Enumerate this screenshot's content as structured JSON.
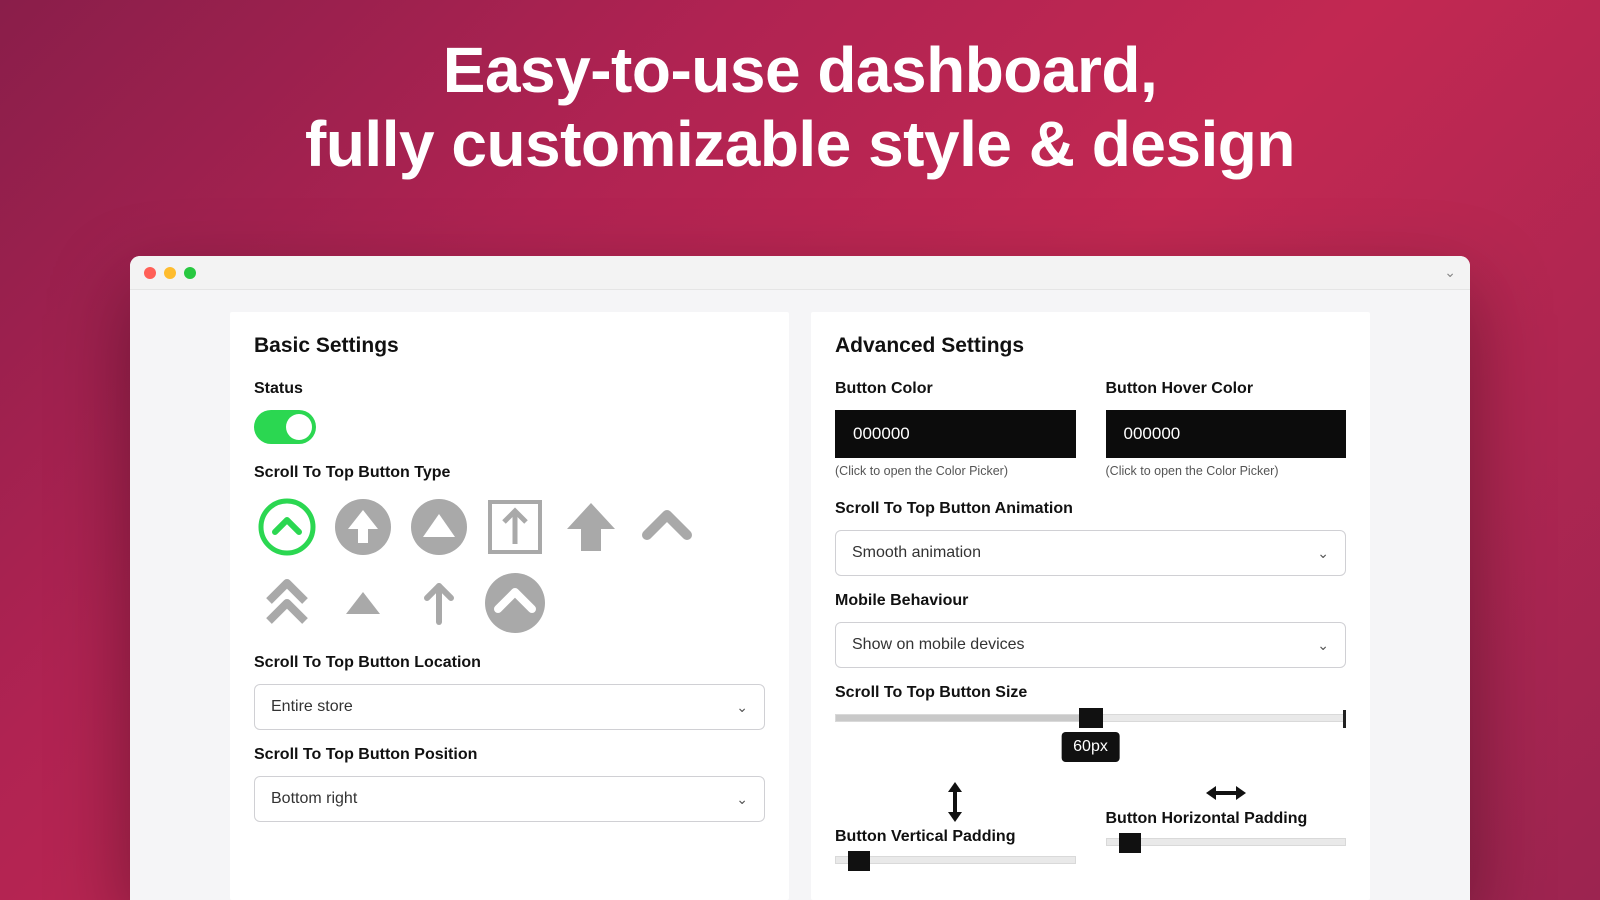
{
  "hero_line1": "Easy-to-use dashboard,",
  "hero_line2": "fully customizable style & design",
  "basic": {
    "title": "Basic Settings",
    "status_label": "Status",
    "status_on": true,
    "type_label": "Scroll To Top Button Type",
    "location_label": "Scroll To Top Button Location",
    "location_value": "Entire store",
    "position_label": "Scroll To Top Button Position",
    "position_value": "Bottom right"
  },
  "advanced": {
    "title": "Advanced Settings",
    "button_color_label": "Button Color",
    "button_color_value": "000000",
    "hover_color_label": "Button Hover Color",
    "hover_color_value": "000000",
    "color_hint": "(Click to open the Color Picker)",
    "animation_label": "Scroll To Top Button Animation",
    "animation_value": "Smooth animation",
    "mobile_label": "Mobile Behaviour",
    "mobile_value": "Show on mobile devices",
    "size_label": "Scroll To Top Button Size",
    "size_value": "60px",
    "vpad_label": "Button Vertical Padding",
    "hpad_label": "Button Horizontal Padding"
  },
  "colors": {
    "accent": "#2bd751",
    "icon": "#a9a9a9"
  }
}
